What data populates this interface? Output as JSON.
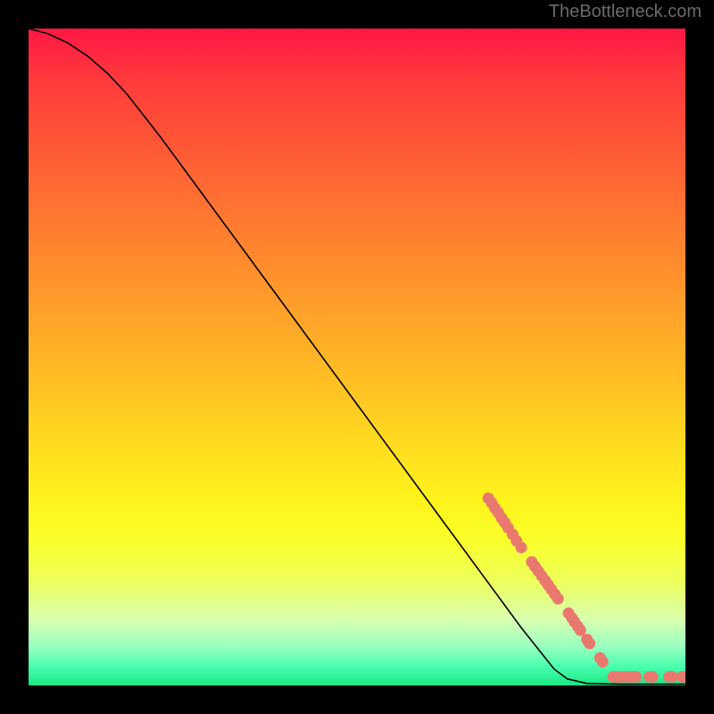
{
  "attribution": "TheBottleneck.com",
  "chart_data": {
    "type": "line",
    "title": "",
    "xlabel": "",
    "ylabel": "",
    "xlim": [
      0,
      100
    ],
    "ylim": [
      0,
      100
    ],
    "curve": [
      {
        "x": 0.0,
        "y": 100.0
      },
      {
        "x": 3.0,
        "y": 99.2
      },
      {
        "x": 6.0,
        "y": 97.8
      },
      {
        "x": 9.0,
        "y": 95.8
      },
      {
        "x": 12.0,
        "y": 93.2
      },
      {
        "x": 15.0,
        "y": 90.0
      },
      {
        "x": 20.0,
        "y": 83.6
      },
      {
        "x": 25.0,
        "y": 76.8
      },
      {
        "x": 30.0,
        "y": 70.0
      },
      {
        "x": 35.0,
        "y": 63.2
      },
      {
        "x": 40.0,
        "y": 56.4
      },
      {
        "x": 45.0,
        "y": 49.6
      },
      {
        "x": 50.0,
        "y": 42.8
      },
      {
        "x": 55.0,
        "y": 36.0
      },
      {
        "x": 60.0,
        "y": 29.2
      },
      {
        "x": 65.0,
        "y": 22.4
      },
      {
        "x": 70.0,
        "y": 15.6
      },
      {
        "x": 75.0,
        "y": 8.8
      },
      {
        "x": 80.0,
        "y": 2.5
      },
      {
        "x": 82.0,
        "y": 1.0
      },
      {
        "x": 85.0,
        "y": 0.3
      },
      {
        "x": 90.0,
        "y": 0.2
      },
      {
        "x": 95.0,
        "y": 0.2
      },
      {
        "x": 100.0,
        "y": 0.2
      }
    ],
    "markers": [
      {
        "x": 70.0,
        "y": 28.5
      },
      {
        "x": 70.5,
        "y": 27.8
      },
      {
        "x": 71.0,
        "y": 27.0
      },
      {
        "x": 71.5,
        "y": 26.3
      },
      {
        "x": 72.0,
        "y": 25.5
      },
      {
        "x": 72.5,
        "y": 24.8
      },
      {
        "x": 73.0,
        "y": 24.0
      },
      {
        "x": 73.7,
        "y": 23.0
      },
      {
        "x": 74.3,
        "y": 22.0
      },
      {
        "x": 75.0,
        "y": 21.0
      },
      {
        "x": 76.6,
        "y": 18.8
      },
      {
        "x": 77.1,
        "y": 18.1
      },
      {
        "x": 77.6,
        "y": 17.4
      },
      {
        "x": 78.1,
        "y": 16.7
      },
      {
        "x": 78.6,
        "y": 16.0
      },
      {
        "x": 79.1,
        "y": 15.3
      },
      {
        "x": 79.6,
        "y": 14.6
      },
      {
        "x": 80.1,
        "y": 13.9
      },
      {
        "x": 80.6,
        "y": 13.2
      },
      {
        "x": 82.2,
        "y": 11.0
      },
      {
        "x": 82.7,
        "y": 10.3
      },
      {
        "x": 83.1,
        "y": 9.7
      },
      {
        "x": 83.6,
        "y": 9.0
      },
      {
        "x": 84.0,
        "y": 8.4
      },
      {
        "x": 85.0,
        "y": 7.0
      },
      {
        "x": 85.4,
        "y": 6.4
      },
      {
        "x": 87.0,
        "y": 4.2
      },
      {
        "x": 87.4,
        "y": 3.6
      },
      {
        "x": 89.0,
        "y": 1.3
      },
      {
        "x": 89.5,
        "y": 1.3
      },
      {
        "x": 90.0,
        "y": 1.3
      },
      {
        "x": 90.5,
        "y": 1.3
      },
      {
        "x": 91.0,
        "y": 1.3
      },
      {
        "x": 91.5,
        "y": 1.3
      },
      {
        "x": 92.0,
        "y": 1.3
      },
      {
        "x": 92.5,
        "y": 1.3
      },
      {
        "x": 94.5,
        "y": 1.3
      },
      {
        "x": 95.0,
        "y": 1.3
      },
      {
        "x": 97.5,
        "y": 1.3
      },
      {
        "x": 98.0,
        "y": 1.3
      },
      {
        "x": 99.5,
        "y": 1.3
      },
      {
        "x": 100.0,
        "y": 1.3
      }
    ],
    "marker_color": "#e9796f",
    "curve_color": "#000000"
  }
}
